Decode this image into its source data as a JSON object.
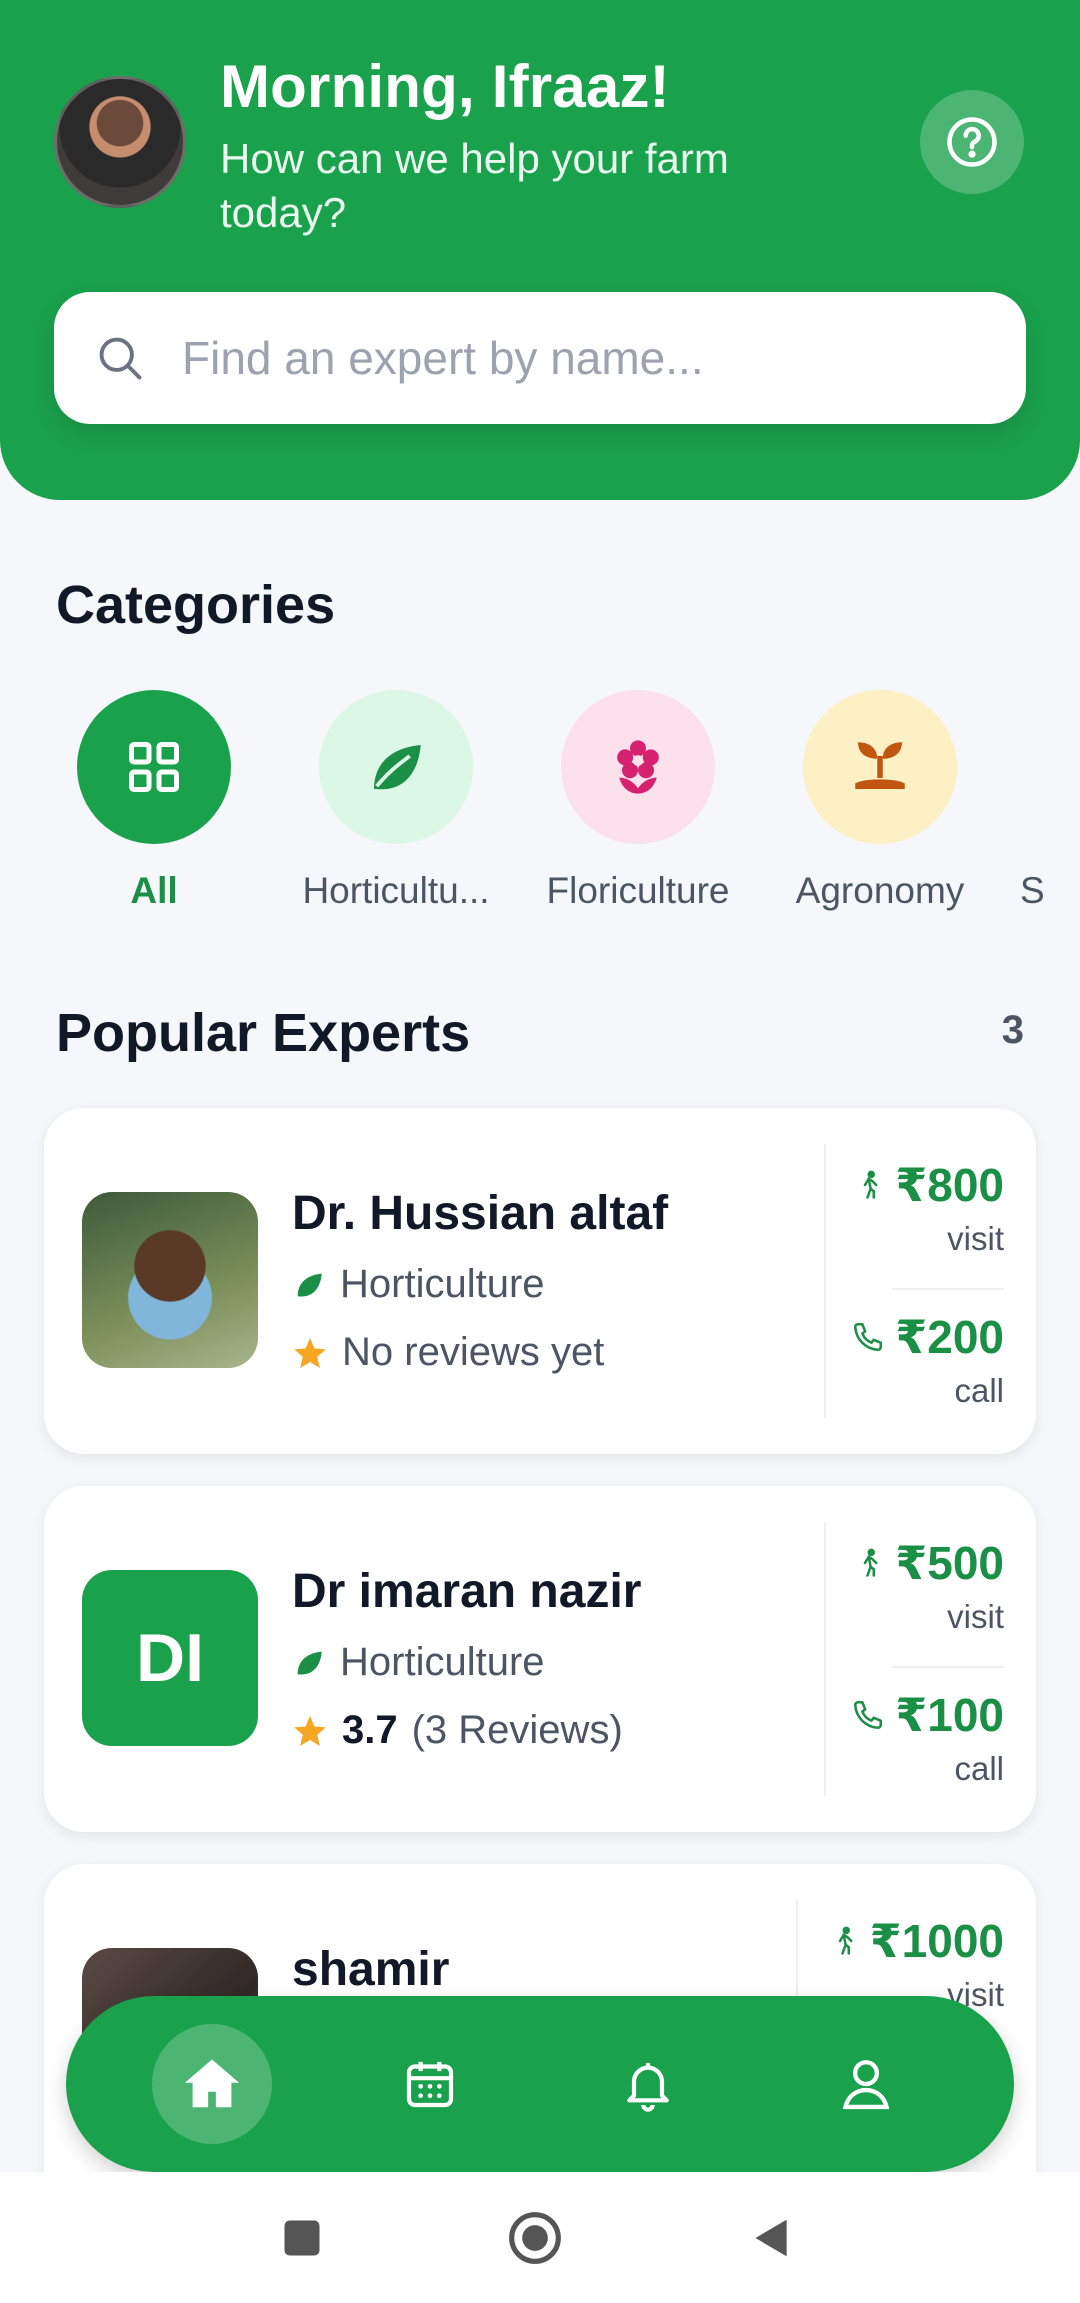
{
  "header": {
    "greeting": "Morning, Ifraaz!",
    "subtitle": "How can we help your farm today?",
    "brand_color": "#1AA14C"
  },
  "search": {
    "placeholder": "Find an expert by name..."
  },
  "categories": {
    "title": "Categories",
    "items": [
      {
        "label": "All",
        "icon": "grid-icon",
        "active": true
      },
      {
        "label": "Horticultu...",
        "icon": "leaf-icon"
      },
      {
        "label": "Floriculture",
        "icon": "flower-icon"
      },
      {
        "label": "Agronomy",
        "icon": "sprout-icon"
      },
      {
        "label": "S"
      }
    ]
  },
  "experts": {
    "title": "Popular Experts",
    "count": "3",
    "items": [
      {
        "name": "Dr. Hussian altaf",
        "category": "Horticulture",
        "rating_text": "No reviews yet",
        "visit_price": "₹800",
        "visit_label": "visit",
        "call_price": "₹200",
        "call_label": "call"
      },
      {
        "name": "Dr imaran nazir",
        "initials": "DI",
        "category": "Horticulture",
        "rating_score": "3.7",
        "rating_reviews": "(3 Reviews)",
        "visit_price": "₹500",
        "visit_label": "visit",
        "call_price": "₹100",
        "call_label": "call"
      },
      {
        "name": "shamir",
        "visit_price": "₹1000",
        "visit_label": "visit"
      }
    ]
  },
  "nav": {
    "items": [
      "home-icon",
      "calendar-icon",
      "bell-icon",
      "user-icon"
    ],
    "active": "home-icon"
  },
  "system_nav": [
    "recents-button",
    "home-button",
    "back-button"
  ]
}
